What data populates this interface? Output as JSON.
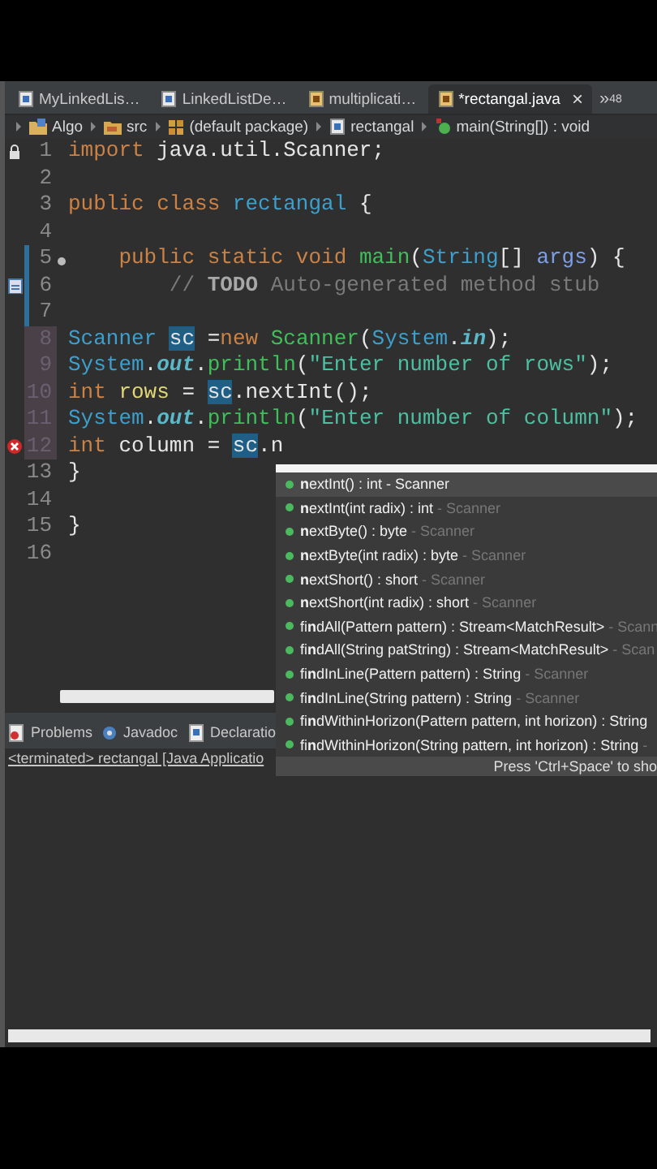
{
  "editor_tabs": [
    {
      "label": "MyLinkedLis…",
      "selected": false
    },
    {
      "label": "LinkedListDe…",
      "selected": false
    },
    {
      "label": "multiplicati…",
      "selected": false
    },
    {
      "label": "*rectangal.java",
      "selected": true,
      "close": "×"
    }
  ],
  "tabs_overflow": {
    "symbol": "»",
    "count": "48"
  },
  "breadcrumb": [
    {
      "label": "Algo"
    },
    {
      "label": "src"
    },
    {
      "label": "(default package)"
    },
    {
      "label": "rectangal"
    },
    {
      "label": "main(String[]) : void"
    }
  ],
  "code_lines": [
    {
      "number": "1",
      "kind": "fold",
      "changed": false,
      "highlighted": false,
      "tokens": [
        {
          "text": "import",
          "kind": "keyword"
        },
        {
          "text": " java.util.Scanner;",
          "kind": "plain"
        }
      ]
    },
    {
      "number": "2",
      "kind": "plain",
      "changed": false,
      "highlighted": false
    },
    {
      "number": "3",
      "kind": "plain",
      "changed": false,
      "highlighted": false,
      "tokens": [
        {
          "text": "public class",
          "kind": "keyword"
        },
        {
          "text": " rectangal",
          "kind": "type"
        },
        {
          "text": " {",
          "kind": "plain"
        }
      ]
    },
    {
      "number": "4",
      "kind": "plain",
      "changed": false,
      "highlighted": false
    },
    {
      "number": "5",
      "kind": "fold_dot",
      "changed": true,
      "highlighted": false,
      "tokens": [
        {
          "text": "    public static void",
          "kind": "keyword"
        },
        {
          "text": " main",
          "kind": "method"
        },
        {
          "text": "(",
          "kind": "plain"
        },
        {
          "text": "String",
          "kind": "type"
        },
        {
          "text": "[] ",
          "kind": "plain"
        },
        {
          "text": "args",
          "kind": "param"
        },
        {
          "text": ") {",
          "kind": "plain"
        }
      ]
    },
    {
      "number": "6",
      "kind": "task",
      "changed": true,
      "highlighted": false,
      "tokens": [
        {
          "text": "        // ",
          "kind": "comment"
        },
        {
          "text": "TODO",
          "kind": "todo"
        },
        {
          "text": " Auto-generated method stub",
          "kind": "comment"
        }
      ]
    },
    {
      "number": "7",
      "kind": "plain",
      "changed": true,
      "highlighted": false
    },
    {
      "number": "8",
      "kind": "plain",
      "changed": false,
      "highlighted": true,
      "tokens": [
        {
          "text": "Scanner ",
          "kind": "type"
        },
        {
          "text": "sc",
          "kind": "occurrence"
        },
        {
          "text": " =",
          "kind": "plain"
        },
        {
          "text": "new",
          "kind": "keyword"
        },
        {
          "text": " Scanner",
          "kind": "method"
        },
        {
          "text": "(",
          "kind": "plain"
        },
        {
          "text": "System",
          "kind": "type"
        },
        {
          "text": ".",
          "kind": "plain"
        },
        {
          "text": "in",
          "kind": "field"
        },
        {
          "text": ");",
          "kind": "plain"
        }
      ]
    },
    {
      "number": "9",
      "kind": "plain",
      "changed": false,
      "highlighted": true,
      "tokens": [
        {
          "text": "System",
          "kind": "type"
        },
        {
          "text": ".",
          "kind": "plain"
        },
        {
          "text": "out",
          "kind": "field"
        },
        {
          "text": ".",
          "kind": "plain"
        },
        {
          "text": "println",
          "kind": "method"
        },
        {
          "text": "(",
          "kind": "plain"
        },
        {
          "text": "\"Enter number of rows\"",
          "kind": "string"
        },
        {
          "text": ");",
          "kind": "plain"
        }
      ]
    },
    {
      "number": "10",
      "kind": "plain",
      "changed": false,
      "highlighted": true,
      "tokens": [
        {
          "text": "int",
          "kind": "keyword"
        },
        {
          "text": " rows",
          "kind": "variable"
        },
        {
          "text": " = ",
          "kind": "plain"
        },
        {
          "text": "sc",
          "kind": "occurrence"
        },
        {
          "text": ".nextInt();",
          "kind": "plain"
        }
      ]
    },
    {
      "number": "11",
      "kind": "plain",
      "changed": false,
      "highlighted": true,
      "tokens": [
        {
          "text": "System",
          "kind": "type"
        },
        {
          "text": ".",
          "kind": "plain"
        },
        {
          "text": "out",
          "kind": "field"
        },
        {
          "text": ".",
          "kind": "plain"
        },
        {
          "text": "println",
          "kind": "method"
        },
        {
          "text": "(",
          "kind": "plain"
        },
        {
          "text": "\"Enter number of column\"",
          "kind": "string"
        },
        {
          "text": ");",
          "kind": "plain"
        }
      ]
    },
    {
      "number": "12",
      "kind": "error",
      "changed": false,
      "highlighted": true,
      "tokens": [
        {
          "text": "int",
          "kind": "keyword"
        },
        {
          "text": " column = ",
          "kind": "plain"
        },
        {
          "text": "sc",
          "kind": "occurrence"
        },
        {
          "text": ".n",
          "kind": "plain"
        }
      ]
    },
    {
      "number": "13",
      "kind": "plain",
      "changed": false,
      "highlighted": false,
      "tokens": [
        {
          "text": "}",
          "kind": "plain"
        }
      ]
    },
    {
      "number": "14",
      "kind": "plain",
      "changed": false,
      "highlighted": false
    },
    {
      "number": "15",
      "kind": "plain",
      "changed": false,
      "highlighted": false,
      "tokens": [
        {
          "text": "}",
          "kind": "plain"
        }
      ]
    },
    {
      "number": "16",
      "kind": "plain",
      "changed": false,
      "highlighted": false
    }
  ],
  "completion": {
    "items": [
      {
        "label": "**n**extInt() : int",
        "owner": "- Scanner",
        "selected": true
      },
      {
        "label": "**n**extInt(int radix) : int",
        "owner": "- Scanner",
        "selected": false
      },
      {
        "label": "**n**extByte() : byte",
        "owner": "- Scanner",
        "selected": false
      },
      {
        "label": "**n**extByte(int radix) : byte",
        "owner": "- Scanner",
        "selected": false
      },
      {
        "label": "**n**extShort() : short",
        "owner": "- Scanner",
        "selected": false
      },
      {
        "label": "**n**extShort(int radix) : short",
        "owner": "- Scanner",
        "selected": false
      },
      {
        "label": "fi**n**dAll(Pattern pattern) : Stream<MatchResult>",
        "owner": "- Scann",
        "selected": false
      },
      {
        "label": "fi**n**dAll(String patString) : Stream<MatchResult>",
        "owner": "- Scan",
        "selected": false
      },
      {
        "label": "fi**n**dInLine(Pattern pattern) : String",
        "owner": "- Scanner",
        "selected": false
      },
      {
        "label": "fi**n**dInLine(String pattern) : String",
        "owner": "- Scanner",
        "selected": false
      },
      {
        "label": "fi**n**dWithinHorizon(Pattern pattern, int horizon) : String",
        "selected": false
      },
      {
        "label": "fi**n**dWithinHorizon(String pattern, int horizon) : String",
        "owner": "-",
        "selected": false
      }
    ],
    "hint": "Press 'Ctrl+Space' to sho"
  },
  "bottom_tabs": [
    {
      "label": "Problems"
    },
    {
      "label": "Javadoc"
    },
    {
      "label": "Declaratio"
    }
  ],
  "console_header": "<terminated> rectangal [Java Applicatio"
}
